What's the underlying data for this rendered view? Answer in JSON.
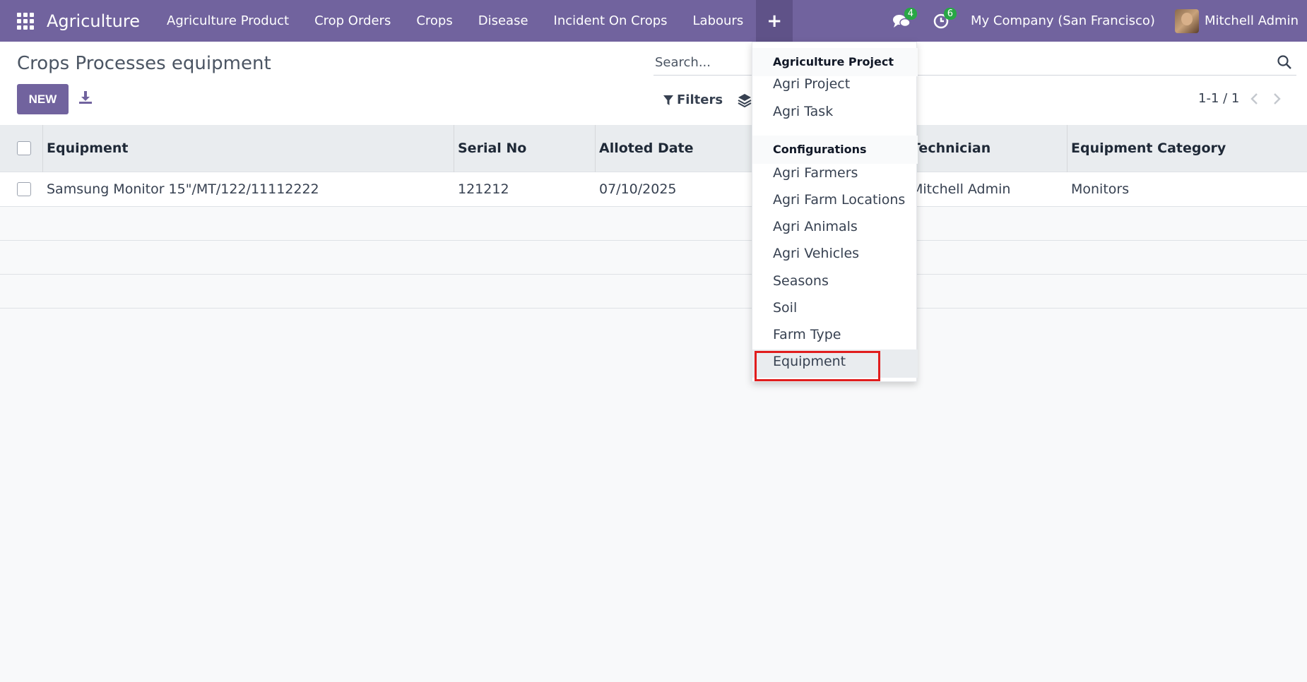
{
  "navbar": {
    "brand": "Agriculture",
    "menu": [
      "Agriculture Product",
      "Crop Orders",
      "Crops",
      "Disease",
      "Incident On Crops",
      "Labours"
    ],
    "plus_label": "+",
    "messages_count": "4",
    "activities_count": "6",
    "company": "My Company (San Francisco)",
    "user": "Mitchell Admin"
  },
  "control": {
    "title": "Crops Processes equipment",
    "new_label": "NEW",
    "search_placeholder": "Search...",
    "filters_label": "Filters",
    "pager": "1-1 / 1"
  },
  "table": {
    "headers": [
      "Equipment",
      "Serial No",
      "Alloted Date",
      "Technician",
      "Equipment Category"
    ],
    "rows": [
      {
        "equipment": "Samsung Monitor 15\"/MT/122/11112222",
        "serial": "121212",
        "date": "07/10/2025",
        "technician": "Mitchell Admin",
        "category": "Monitors"
      }
    ]
  },
  "dropdown": {
    "section1": "Agriculture Project",
    "section1_items": [
      "Agri Project",
      "Agri Task"
    ],
    "section2": "Configurations",
    "section2_items": [
      "Agri Farmers",
      "Agri Farm Locations",
      "Agri Animals",
      "Agri Vehicles",
      "Seasons",
      "Soil",
      "Farm Type",
      "Equipment"
    ]
  },
  "colors": {
    "navbar": "#71639e",
    "primary_button": "#71639e",
    "badge": "#28a745",
    "highlight": "#e11d1d"
  }
}
